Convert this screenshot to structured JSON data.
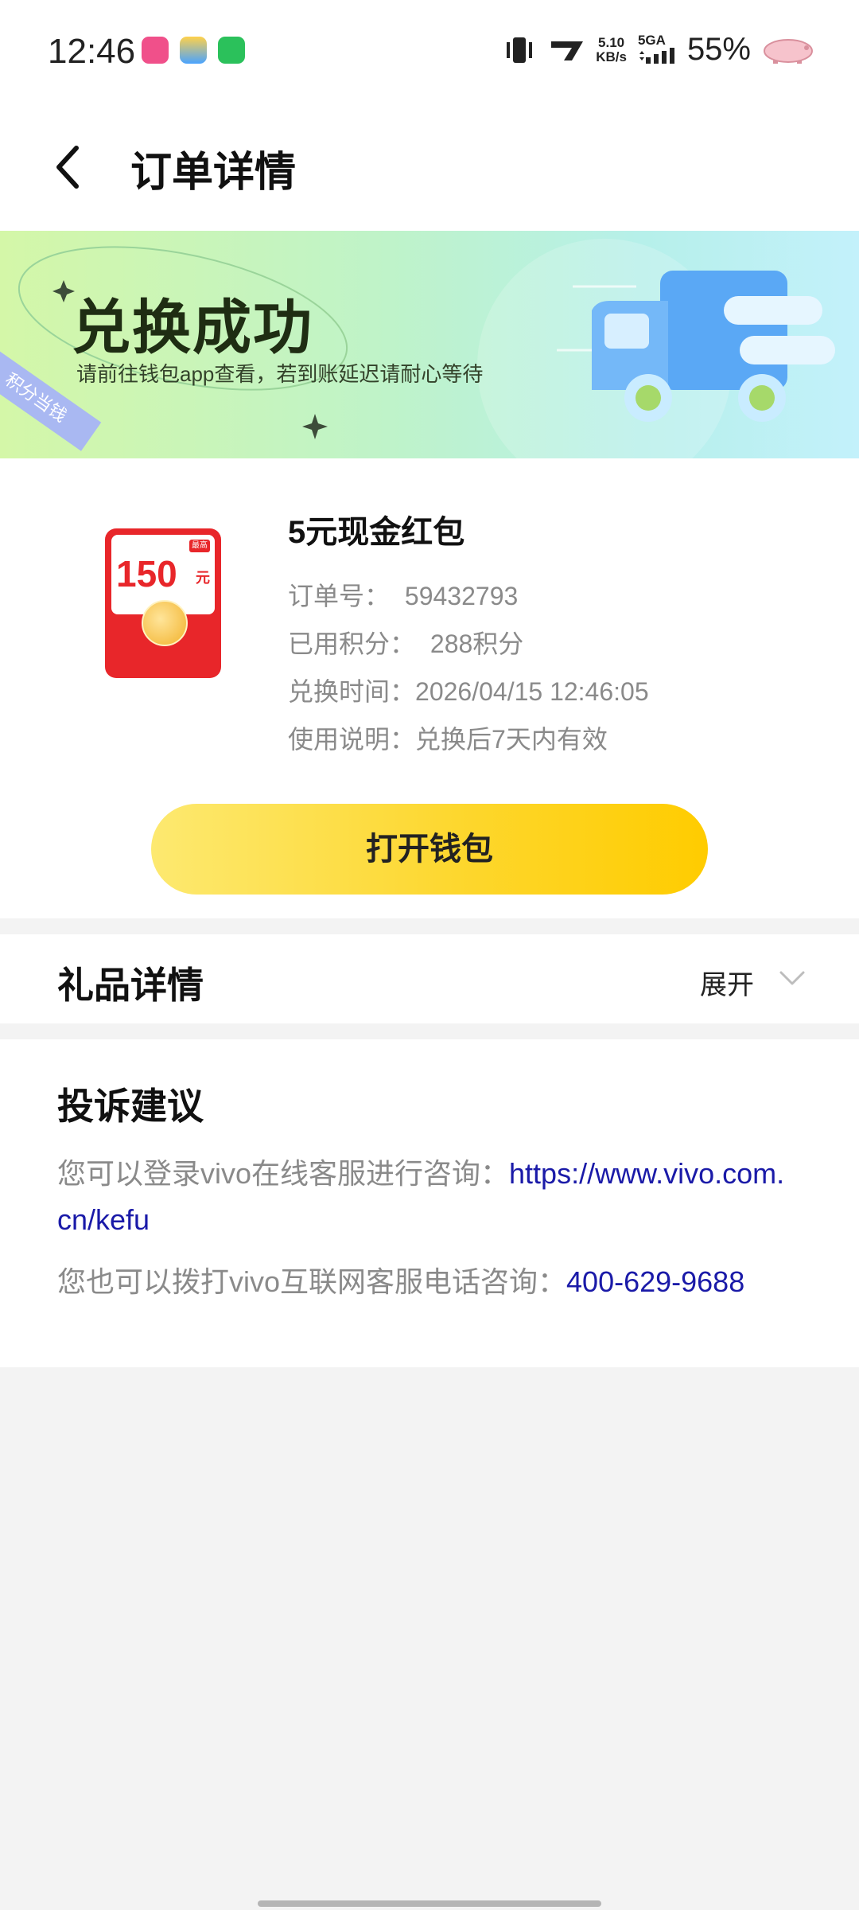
{
  "status_bar": {
    "time": "12:46",
    "speed_value": "5.10",
    "speed_unit": "KB/s",
    "network": "5GA",
    "battery": "55%"
  },
  "header": {
    "title": "订单详情"
  },
  "banner": {
    "title": "兑换成功",
    "subtitle": "请前往钱包app查看，若到账延迟请耐心等待",
    "ribbon": "积分当钱"
  },
  "order": {
    "product_name": "5元现金红包",
    "redpacket_amount": "150",
    "redpacket_unit": "元",
    "redpacket_tag": "最高",
    "order_no_label": "订单号：",
    "order_no": "59432793",
    "points_label": "已用积分：",
    "points": "288积分",
    "time_label": "兑换时间：",
    "time": "2026/04/15 12:46:05",
    "usage_label": "使用说明：",
    "usage": "兑换后7天内有效",
    "button": "打开钱包"
  },
  "gift": {
    "title": "礼品详情",
    "expand": "展开"
  },
  "complaint": {
    "title": "投诉建议",
    "text1": "您可以登录vivo在线客服进行咨询：",
    "link1": "https://www.vivo.com.cn/kefu",
    "text2": "您也可以拨打vivo互联网客服电话咨询：",
    "phone": "400-629-9688"
  },
  "colors": {
    "accent_yellow": "#fdd72e",
    "link_blue": "#1a1aa8",
    "red": "#e8262a"
  }
}
